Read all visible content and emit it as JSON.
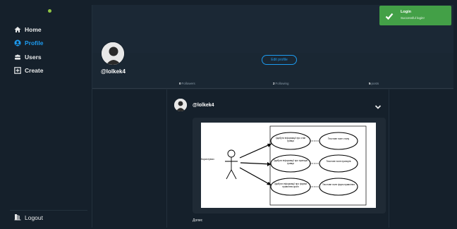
{
  "sidebar": {
    "items": [
      {
        "label": "Home",
        "icon": "home-icon",
        "active": false
      },
      {
        "label": "Profile",
        "icon": "user-circle-icon",
        "active": true
      },
      {
        "label": "Users",
        "icon": "users-icon",
        "active": false
      },
      {
        "label": "Create",
        "icon": "plus-square-icon",
        "active": false
      }
    ],
    "logout_label": "Logout",
    "logout_icon": "logout-icon"
  },
  "profile": {
    "handle": "@lolkek4",
    "edit_label": "Edit profile",
    "stats": [
      {
        "count": "0",
        "label": "Followers"
      },
      {
        "count": "2",
        "label": "Following"
      },
      {
        "count": "5",
        "label": "posts"
      }
    ]
  },
  "post": {
    "handle": "@lolkek4",
    "caption": "Допис",
    "diagram": {
      "actor": "Користувач",
      "use_cases": [
        "Здобути інформації про стан гравця",
        "Здобути інформації про прапори гравця",
        "Здобути інформації про форми правління країн"
      ],
      "extensions": [
        "Текстове поле стану",
        "Текстове поле прапорів",
        "Текстове поле форм правління"
      ]
    }
  },
  "toast": {
    "title": "Login",
    "message": "Successful login!",
    "color": "#43a047"
  },
  "colors": {
    "background": "#15202b",
    "accent": "#1d9bf0",
    "success": "#43a047"
  }
}
